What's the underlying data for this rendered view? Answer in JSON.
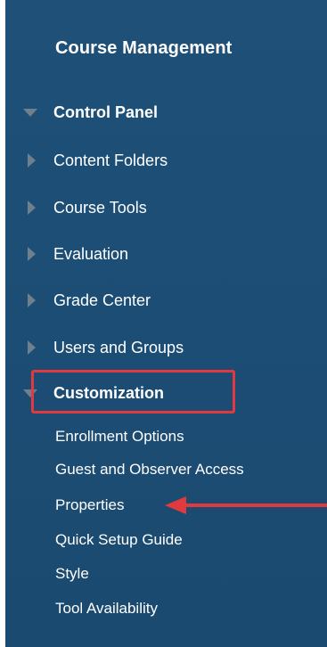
{
  "panel": {
    "title": "Course Management"
  },
  "control_panel": {
    "label": "Control Panel",
    "items": [
      {
        "label": "Content Folders"
      },
      {
        "label": "Course Tools"
      },
      {
        "label": "Evaluation"
      },
      {
        "label": "Grade Center"
      },
      {
        "label": "Users and Groups"
      }
    ]
  },
  "customization": {
    "label": "Customization",
    "items": [
      {
        "label": "Enrollment Options"
      },
      {
        "label": "Guest and Observer Access"
      },
      {
        "label": "Properties"
      },
      {
        "label": "Quick Setup Guide"
      },
      {
        "label": "Style"
      },
      {
        "label": "Tool Availability"
      }
    ]
  },
  "annotation": {
    "highlight_color": "#e03a3e",
    "arrow_color": "#e03a3e"
  },
  "colors": {
    "panel_bg": "#1e5078",
    "text": "#ffffff",
    "disclosure_triangle": "#6e7f8d"
  }
}
